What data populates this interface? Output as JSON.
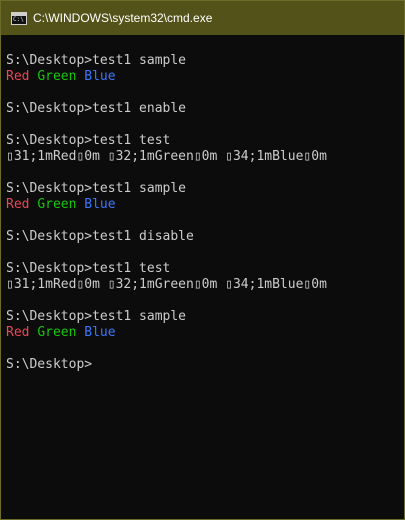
{
  "window": {
    "title": "C:\\WINDOWS\\system32\\cmd.exe",
    "icon": "console-app-icon",
    "icon_glyph": "C:\\"
  },
  "colors": {
    "background": "#0c0c0c",
    "text": "#cccccc",
    "red": "#e74856",
    "green": "#16c60c",
    "blue": "#3b78ff",
    "titlebar": "#525219"
  },
  "console": {
    "lines": [
      "S:\\Desktop>test1 sample",
      {
        "red": "Red",
        "green": "Green",
        "blue": "Blue"
      },
      "",
      "S:\\Desktop>test1 enable",
      "",
      "S:\\Desktop>test1 test",
      "▯31;1mRed▯0m ▯32;1mGreen▯0m ▯34;1mBlue▯0m",
      "",
      "S:\\Desktop>test1 sample",
      {
        "red": "Red",
        "green": "Green",
        "blue": "Blue"
      },
      "",
      "S:\\Desktop>test1 disable",
      "",
      "S:\\Desktop>test1 test",
      "▯31;1mRed▯0m ▯32;1mGreen▯0m ▯34;1mBlue▯0m",
      "",
      "S:\\Desktop>test1 sample",
      {
        "red": "Red",
        "green": "Green",
        "blue": "Blue"
      },
      "",
      "S:\\Desktop>"
    ]
  }
}
